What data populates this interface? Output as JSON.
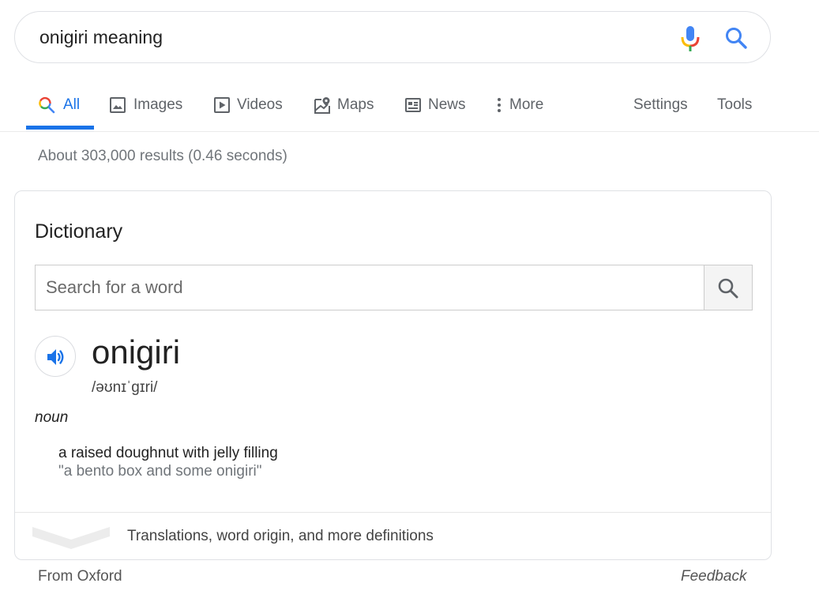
{
  "search": {
    "query": "onigiri meaning",
    "mic_icon": "mic-icon",
    "search_icon": "search-icon"
  },
  "tabs": [
    {
      "label": "All",
      "icon": "search-icon",
      "active": true
    },
    {
      "label": "Images",
      "icon": "image-icon"
    },
    {
      "label": "Videos",
      "icon": "play-icon"
    },
    {
      "label": "Maps",
      "icon": "map-icon"
    },
    {
      "label": "News",
      "icon": "news-icon"
    },
    {
      "label": "More",
      "icon": "more-vert-icon"
    }
  ],
  "tools": {
    "settings": "Settings",
    "tools": "Tools"
  },
  "results": {
    "stats": "About 303,000 results (0.46 seconds)"
  },
  "dictionary": {
    "title": "Dictionary",
    "search_placeholder": "Search for a word",
    "word": "onigiri",
    "phonetic": "/əʊnɪˈɡɪri/",
    "part_of_speech": "noun",
    "definition": "a raised doughnut with jelly filling",
    "example": "\"a bento box and some onigiri\"",
    "more_link": "Translations, word origin, and more definitions"
  },
  "footer": {
    "source": "From Oxford",
    "feedback": "Feedback"
  },
  "colors": {
    "accent": "#1a73e8",
    "text": "#222222",
    "muted": "#70757a",
    "border": "#dfe1e5"
  }
}
